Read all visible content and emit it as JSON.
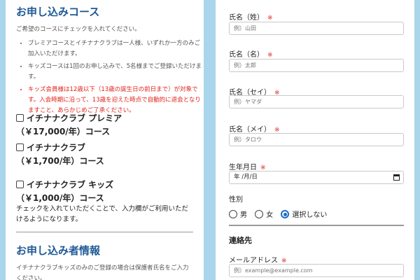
{
  "course_section": {
    "title": "お申し込みコース",
    "intro": "ご希望のコースにチェックを入れてください。",
    "notes": [
      "プレミアコースとイチナナクラブは一人様、いずれか一方のみご加入いただけます。",
      "キッズコースは1回のお申し込みで、5名様までご登録いただけます。"
    ],
    "warning": "キッズ会員様は12歳以下（13歳の誕生日の前日まで）が対象です。入会時期に沿って、13歳を迎えた時点で自動的に退会となりますこと、あらかじめご了承ください。",
    "options": [
      {
        "line1": "イチナナクラブ プレミア",
        "line2": "（￥17,000/年）コース",
        "checked": false
      },
      {
        "line1": "イチナナクラブ",
        "line2": "（￥1,700/年）コース",
        "checked": false
      },
      {
        "line1": "イチナナクラブ キッズ",
        "line2": "（￥1,000/年）コース",
        "checked": false
      }
    ],
    "footnote": "チェックを入れていただくことで、入力欄がご利用いただけるようになります。"
  },
  "applicant_section": {
    "title": "お申し込み者情報",
    "intro": "イチナナクラブキッズのみのご登録の場合は保護者氏名をご入力ください。"
  },
  "form": {
    "required_mark": "※",
    "last_name": {
      "label": "氏名（姓）",
      "placeholder": "例）山田"
    },
    "first_name": {
      "label": "氏名（名）",
      "placeholder": "例）太郎"
    },
    "last_name_kana": {
      "label": "氏名（セイ）",
      "placeholder": "例）ヤマダ"
    },
    "first_name_kana": {
      "label": "氏名（メイ）",
      "placeholder": "例）タロウ"
    },
    "birthdate": {
      "label": "生年月日",
      "value": "年 /月/日"
    },
    "gender": {
      "label": "性別",
      "options": [
        "男",
        "女",
        "選択しない"
      ],
      "selected": "選択しない"
    },
    "contact_title": "連絡先",
    "email": {
      "label": "メールアドレス",
      "placeholder": "例）example@example.com"
    }
  },
  "colors": {
    "background": "#a9d6eb",
    "heading": "#1f5a96",
    "required": "#e0231a",
    "radio_selected": "#1a6dc5"
  }
}
